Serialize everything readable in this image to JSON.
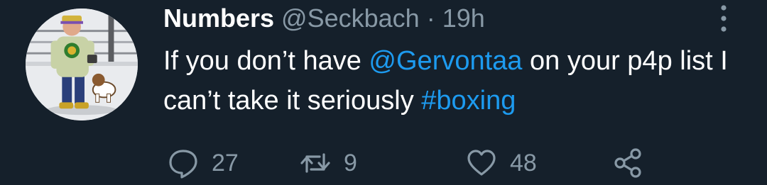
{
  "tweet": {
    "author_name": "Numbers",
    "author_handle": "@Seckbach",
    "separator": "·",
    "time": "19h",
    "text_part1": "If you don’t have ",
    "mention": "@Gervontaa",
    "text_part2": " on your p4p list I can’t take it seriously ",
    "hashtag": "#boxing"
  },
  "actions": {
    "reply_count": "27",
    "retweet_count": "9",
    "like_count": "48"
  },
  "icons": {
    "avatar": "avatar-illustration",
    "more": "more-vertical-icon",
    "reply": "reply-icon",
    "retweet": "retweet-icon",
    "like": "heart-icon",
    "share": "share-icon"
  },
  "colors": {
    "background": "#15202b",
    "secondary_text": "#8899a6",
    "link": "#1d9bf0"
  }
}
